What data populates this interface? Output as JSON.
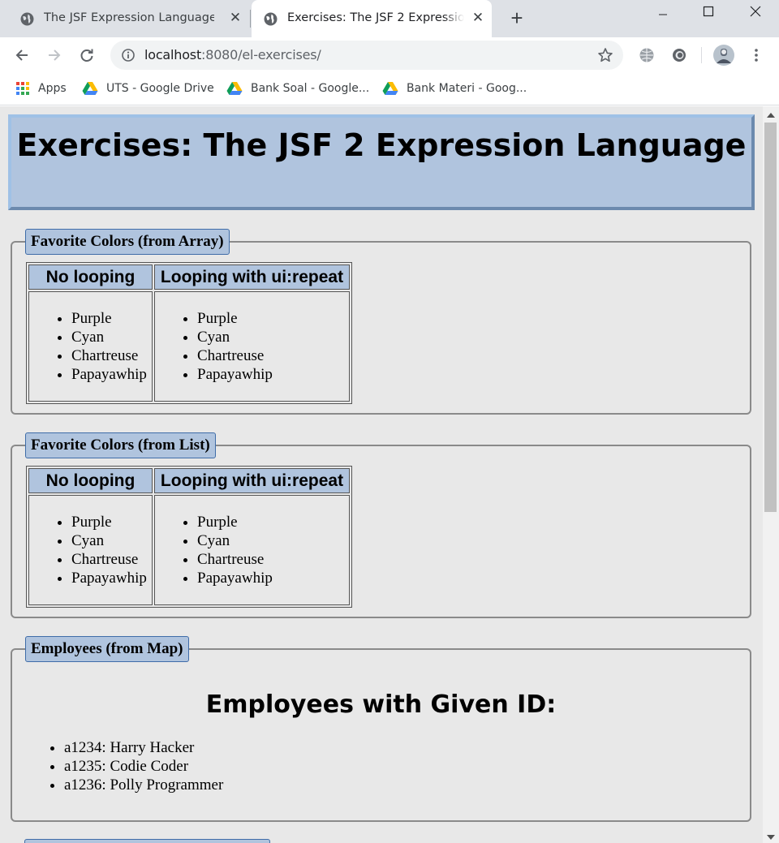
{
  "browser": {
    "tabs": [
      {
        "title": "The JSF Expression Language",
        "active": false
      },
      {
        "title": "Exercises: The JSF 2 Expression Language",
        "active": true
      }
    ],
    "url_host": "localhost",
    "url_path": ":8080/el-exercises/",
    "bookmarks": [
      {
        "label": "Apps",
        "icon": "apps-grid-icon"
      },
      {
        "label": "UTS - Google Drive",
        "icon": "google-drive-icon"
      },
      {
        "label": "Bank Soal - Google...",
        "icon": "google-drive-icon"
      },
      {
        "label": "Bank Materi - Goog...",
        "icon": "google-drive-icon"
      }
    ]
  },
  "page": {
    "title": "Exercises: The JSF 2 Expression Language",
    "sections": [
      {
        "legend": "Favorite Colors (from Array)",
        "headers": [
          "No looping",
          "Looping with ui:repeat"
        ],
        "no_looping": [
          "Purple",
          "Cyan",
          "Chartreuse",
          "Papayawhip"
        ],
        "ui_repeat": [
          "Purple",
          "Cyan",
          "Chartreuse",
          "Papayawhip"
        ]
      },
      {
        "legend": "Favorite Colors (from List)",
        "headers": [
          "No looping",
          "Looping with ui:repeat"
        ],
        "no_looping": [
          "Purple",
          "Cyan",
          "Chartreuse",
          "Papayawhip"
        ],
        "ui_repeat": [
          "Purple",
          "Cyan",
          "Chartreuse",
          "Papayawhip"
        ]
      }
    ],
    "employees": {
      "legend": "Employees (from Map)",
      "heading": "Employees with Given ID:",
      "items": [
        "a1234: Harry Hacker",
        "a1235: Codie Coder",
        "a1236: Polly Programmer"
      ]
    }
  },
  "colors": {
    "header_bg": "#b0c4de",
    "page_bg": "#e8e8e8",
    "legend_border": "#3f6ca8"
  }
}
